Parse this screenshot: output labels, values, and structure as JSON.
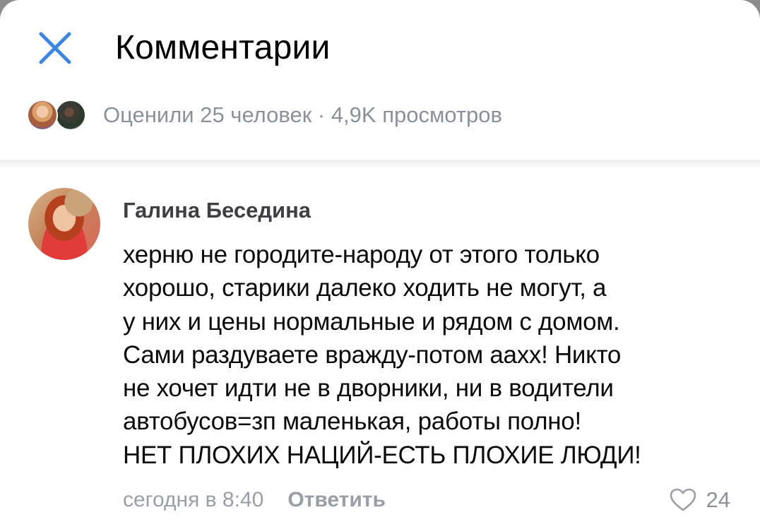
{
  "header": {
    "title": "Комментарии",
    "close_icon": "close-icon",
    "accent_color": "#3a86e8"
  },
  "likes": {
    "text": "Оценили 25 человек · 4,9K просмотров"
  },
  "comment": {
    "author": "Галина Беседина",
    "text": "херню не городите-народу от этого только\nхорошо, старики далеко ходить не могут, а\nу них и цены нормальные и рядом с домом.\nСами раздуваете вражду-потом аахх! Никто\nне хочет идти не в дворники, ни в водители\nавтобусов=зп маленькая, работы полно!\nНЕТ ПЛОХИХ НАЦИЙ-ЕСТЬ ПЛОХИЕ ЛЮДИ!",
    "time": "сегодня в 8:40",
    "reply_label": "Ответить",
    "like_count": "24",
    "like_icon": "heart-icon"
  }
}
